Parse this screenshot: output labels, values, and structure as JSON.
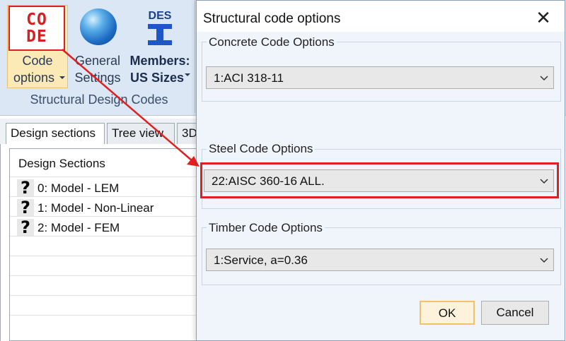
{
  "ribbon": {
    "code_icon_line1": "CO",
    "code_icon_line2": "DE",
    "code_options_line1": "Code",
    "code_options_line2": "options",
    "general_line1": "General",
    "general_line2": "Settings",
    "des_icon_text": "DES",
    "members_line1": "Members:",
    "members_line2": "US Sizes",
    "group_label": "Structural Design Codes",
    "accent_red": "#e02020"
  },
  "tabs": [
    "Design sections",
    "Tree view",
    "3D"
  ],
  "panel": {
    "header": "Design Sections",
    "items": [
      {
        "icon": "question-icon",
        "glyph": "?",
        "label": "0: Model - LEM"
      },
      {
        "icon": "question-icon",
        "glyph": "?",
        "label": "1: Model - Non-Linear"
      },
      {
        "icon": "question-icon",
        "glyph": "?",
        "label": "2: Model - FEM"
      }
    ]
  },
  "dialog": {
    "title": "Structural code options",
    "close_glyph": "✕",
    "concrete": {
      "legend": "Concrete Code Options",
      "value": "1:ACI 318-11"
    },
    "steel": {
      "legend": "Steel Code Options",
      "value": "22:AISC 360-16 ALL."
    },
    "timber": {
      "legend": "Timber Code Options",
      "value": "1:Service, a=0.36"
    },
    "ok_label": "OK",
    "cancel_label": "Cancel"
  }
}
